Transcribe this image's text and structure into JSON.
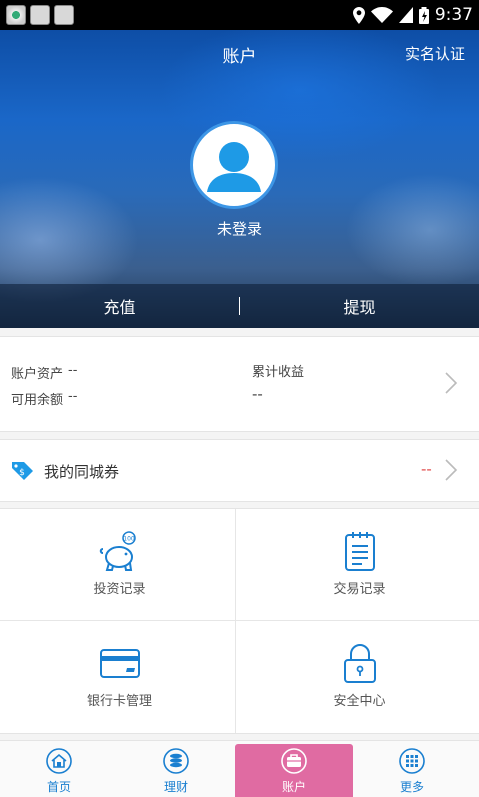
{
  "status_bar": {
    "time": "9:37"
  },
  "header": {
    "title": "账户",
    "verify_label": "实名认证",
    "login_status": "未登录",
    "recharge_label": "充值",
    "withdraw_label": "提现"
  },
  "assets": {
    "total_assets_label": "账户资产",
    "total_assets_value": "--",
    "available_balance_label": "可用余额",
    "available_balance_value": "--",
    "cumulative_income_label": "累计收益",
    "cumulative_income_value": "--"
  },
  "coupon": {
    "label": "我的同城券",
    "count": "--"
  },
  "grid": [
    {
      "label": "投资记录",
      "icon": "piggy-bank-icon"
    },
    {
      "label": "交易记录",
      "icon": "notepad-icon"
    },
    {
      "label": "银行卡管理",
      "icon": "bank-card-icon"
    },
    {
      "label": "安全中心",
      "icon": "lock-icon"
    }
  ],
  "tabs": [
    {
      "label": "首页",
      "icon": "home-icon"
    },
    {
      "label": "理财",
      "icon": "coins-icon"
    },
    {
      "label": "账户",
      "icon": "briefcase-icon",
      "active": true
    },
    {
      "label": "更多",
      "icon": "grid-icon"
    }
  ],
  "colors": {
    "accent": "#1a7fd0",
    "active_tab": "#e06ba2",
    "negative": "#e14a4a"
  }
}
